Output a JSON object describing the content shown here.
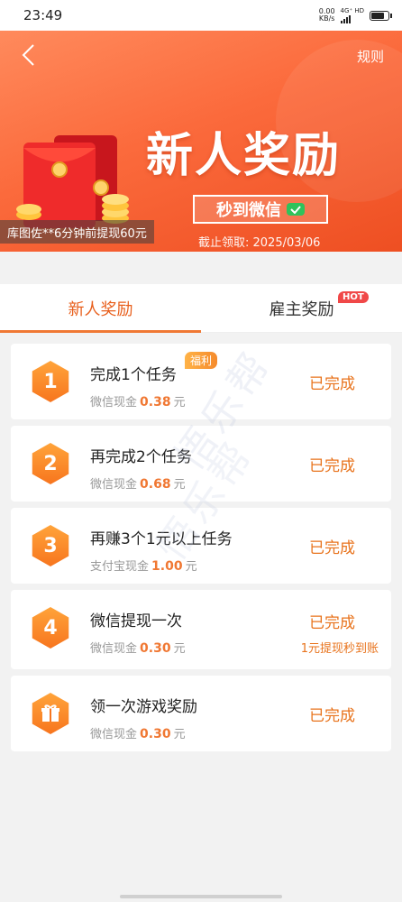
{
  "status_bar": {
    "time": "23:49",
    "speed_value": "0.00",
    "speed_unit": "KB/s",
    "network": "4G⁺ HD"
  },
  "banner": {
    "back_icon": "chevron-left-icon",
    "rules_label": "规则",
    "title": "新人奖励",
    "badge_text": "秒到微信",
    "deadline": "截止领取: 2025/03/06",
    "promo_text": "库图佐**6分钟前提现60元"
  },
  "tabs": {
    "items": [
      {
        "label": "新人奖励"
      },
      {
        "label": "雇主奖励"
      }
    ],
    "hot_badge": "HOT"
  },
  "tasks": [
    {
      "badge": "1",
      "title": "完成1个任务",
      "reward_label": "微信现金",
      "amount": "0.38",
      "unit": "元",
      "status": "已完成",
      "tag": "福利"
    },
    {
      "badge": "2",
      "title": "再完成2个任务",
      "reward_label": "微信现金",
      "amount": "0.68",
      "unit": "元",
      "status": "已完成"
    },
    {
      "badge": "3",
      "title": "再赚3个1元以上任务",
      "reward_label": "支付宝现金",
      "amount": "1.00",
      "unit": "元",
      "status": "已完成"
    },
    {
      "badge": "4",
      "title": "微信提现一次",
      "reward_label": "微信现金",
      "amount": "0.30",
      "unit": "元",
      "status": "已完成",
      "note": "1元提现秒到账"
    },
    {
      "badge_icon": "gift-icon",
      "title": "领一次游戏奖励",
      "reward_label": "微信现金",
      "amount": "0.30",
      "unit": "元",
      "status": "已完成"
    }
  ],
  "watermark": "悟乐帮",
  "colors": {
    "accent": "#f07833",
    "banner": "#fb6a3c",
    "status_text": "#e8731c"
  }
}
